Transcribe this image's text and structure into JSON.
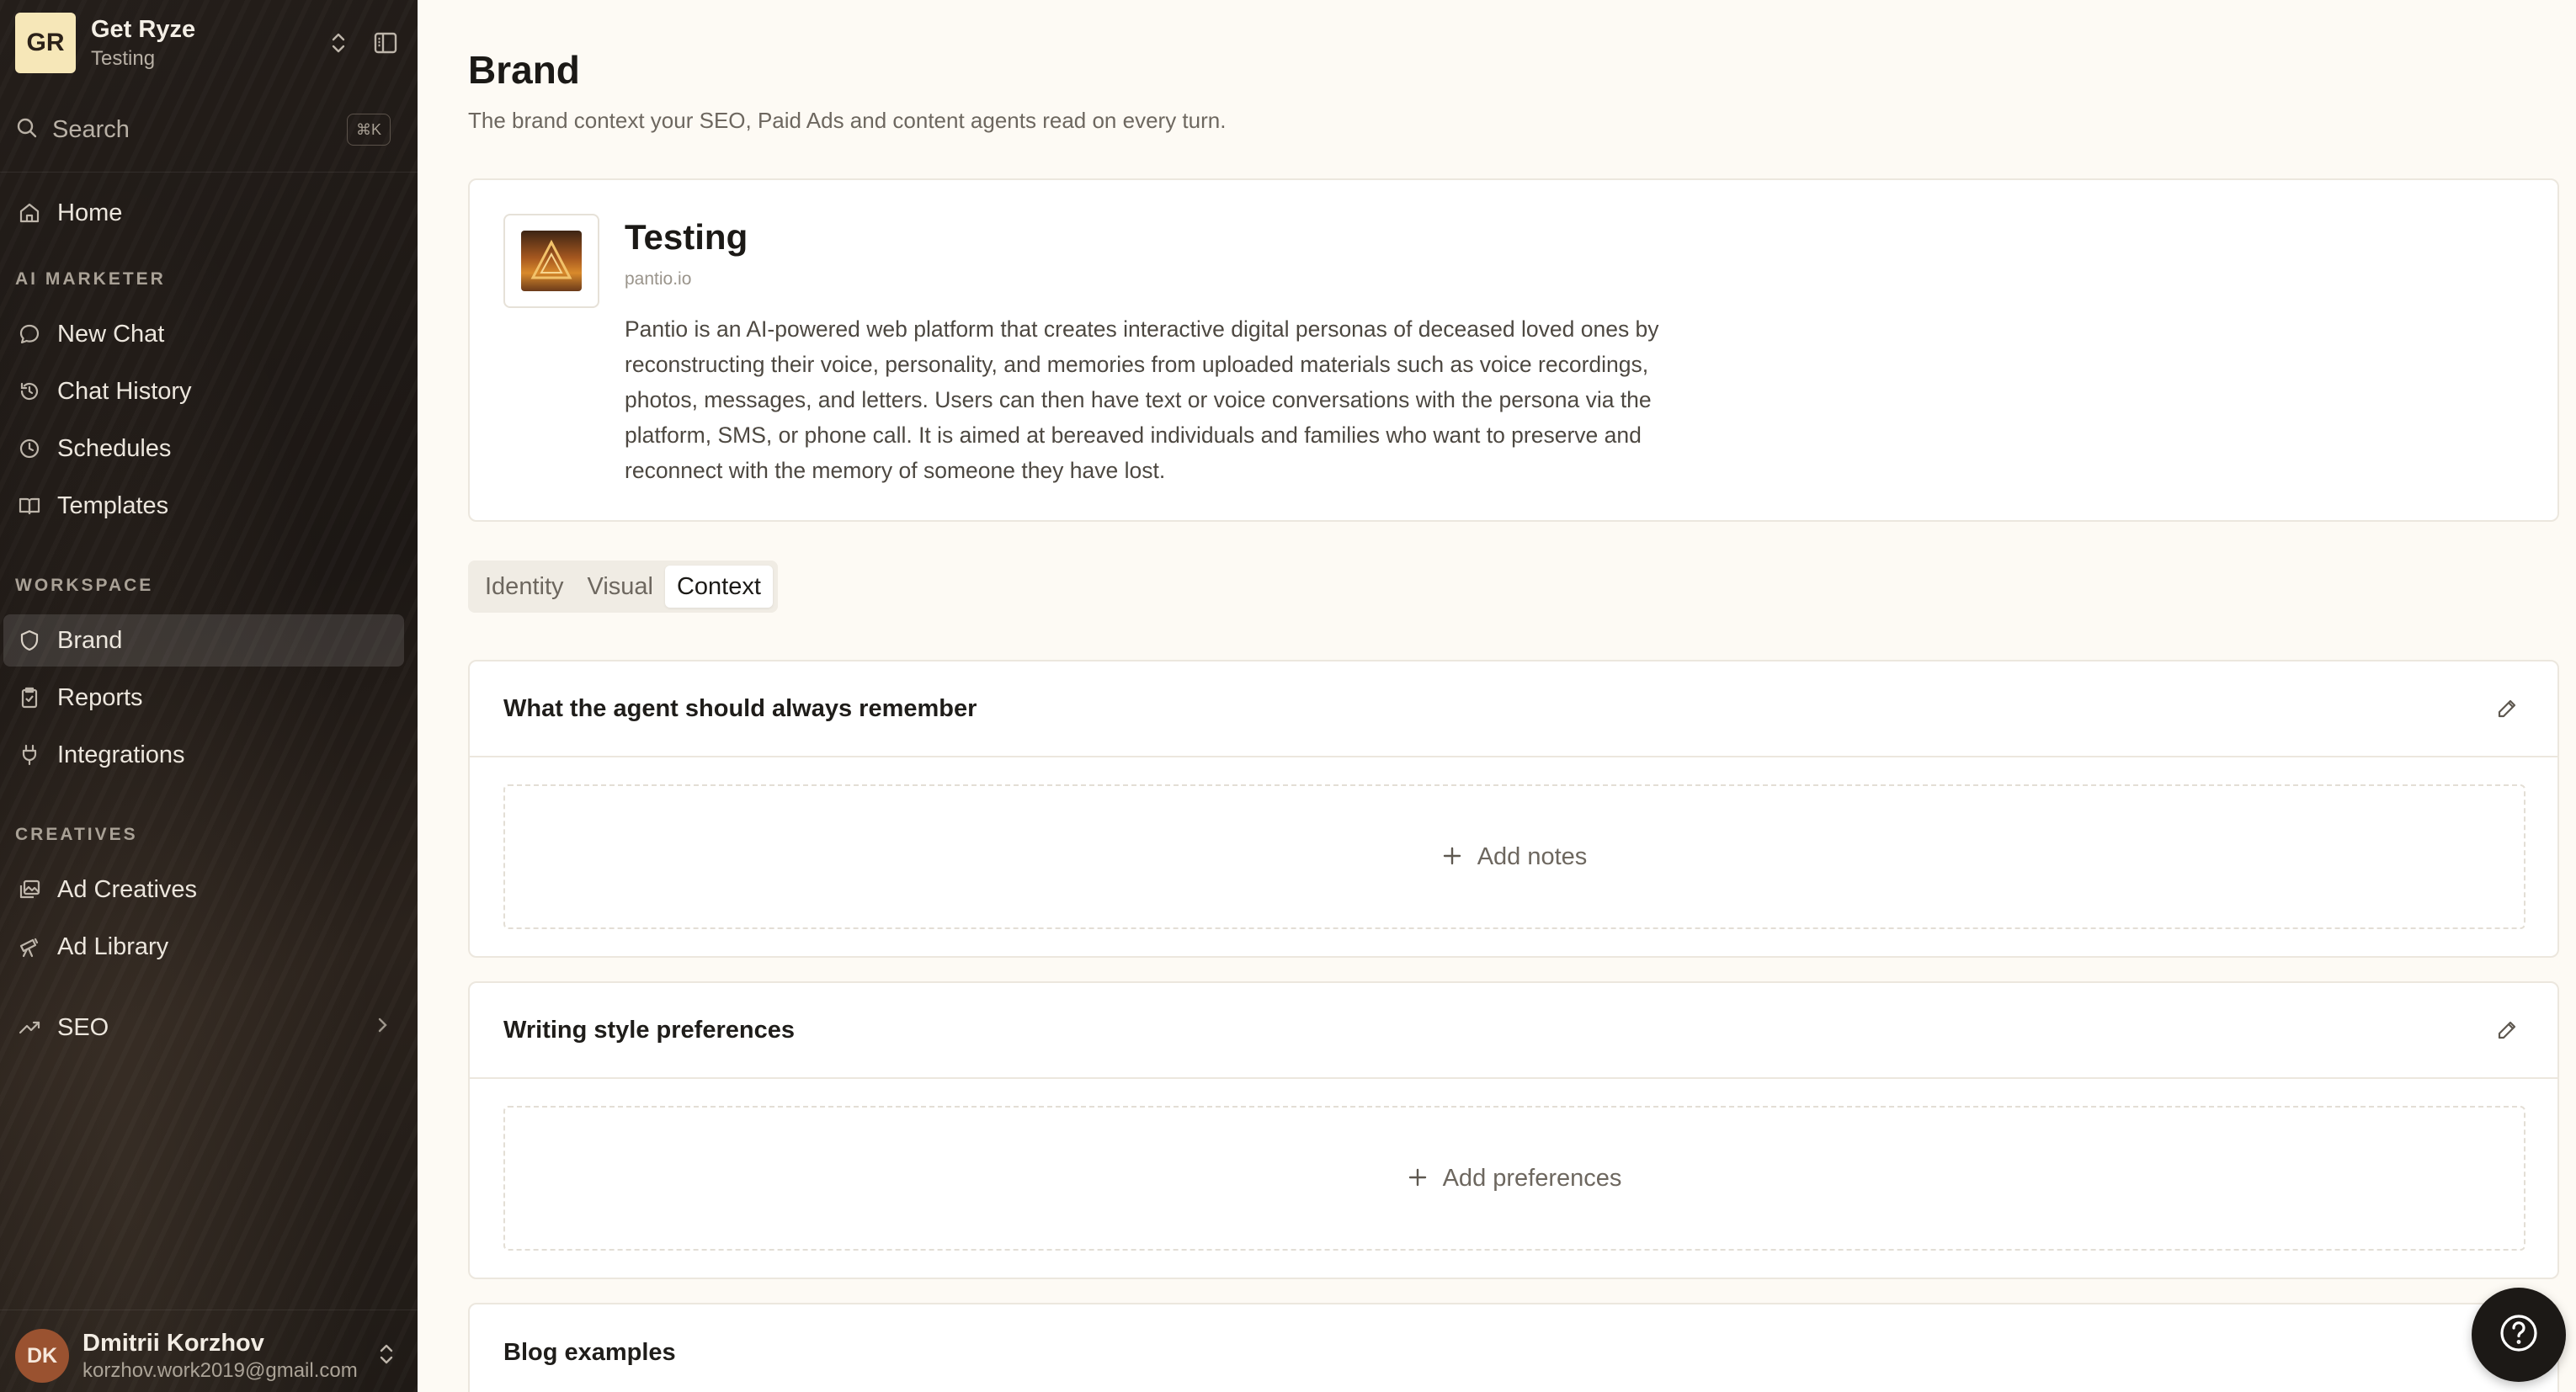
{
  "workspace": {
    "initials": "GR",
    "name": "Get Ryze",
    "subtitle": "Testing"
  },
  "search": {
    "label": "Search",
    "shortcut": "⌘K"
  },
  "nav": {
    "home": "Home",
    "sections": [
      {
        "label": "AI MARKETER",
        "items": [
          "New Chat",
          "Chat History",
          "Schedules",
          "Templates"
        ]
      },
      {
        "label": "WORKSPACE",
        "items": [
          "Brand",
          "Reports",
          "Integrations"
        ]
      },
      {
        "label": "CREATIVES",
        "items": [
          "Ad Creatives",
          "Ad Library"
        ]
      }
    ],
    "seo": "SEO",
    "active": "Brand"
  },
  "user": {
    "initials": "DK",
    "name": "Dmitrii Korzhov",
    "email": "korzhov.work2019@gmail.com"
  },
  "page": {
    "title": "Brand",
    "subtitle": "The brand context your SEO, Paid Ads and content agents read on every turn."
  },
  "brand": {
    "name": "Testing",
    "domain": "pantio.io",
    "description": "Pantio is an AI-powered web platform that creates interactive digital personas of deceased loved ones by reconstructing their voice, personality, and memories from uploaded materials such as voice recordings, photos, messages, and letters. Users can then have text or voice conversations with the persona via the platform, SMS, or phone call. It is aimed at bereaved individuals and families who want to preserve and reconnect with the memory of someone they have lost."
  },
  "tabs": [
    {
      "label": "Identity"
    },
    {
      "label": "Visual"
    },
    {
      "label": "Context",
      "active": true
    }
  ],
  "context_sections": [
    {
      "title": "What the agent should always remember",
      "action": "Add notes"
    },
    {
      "title": "Writing style preferences",
      "action": "Add preferences"
    },
    {
      "title": "Blog examples"
    }
  ],
  "icons": {
    "help": "help-circle-icon"
  }
}
